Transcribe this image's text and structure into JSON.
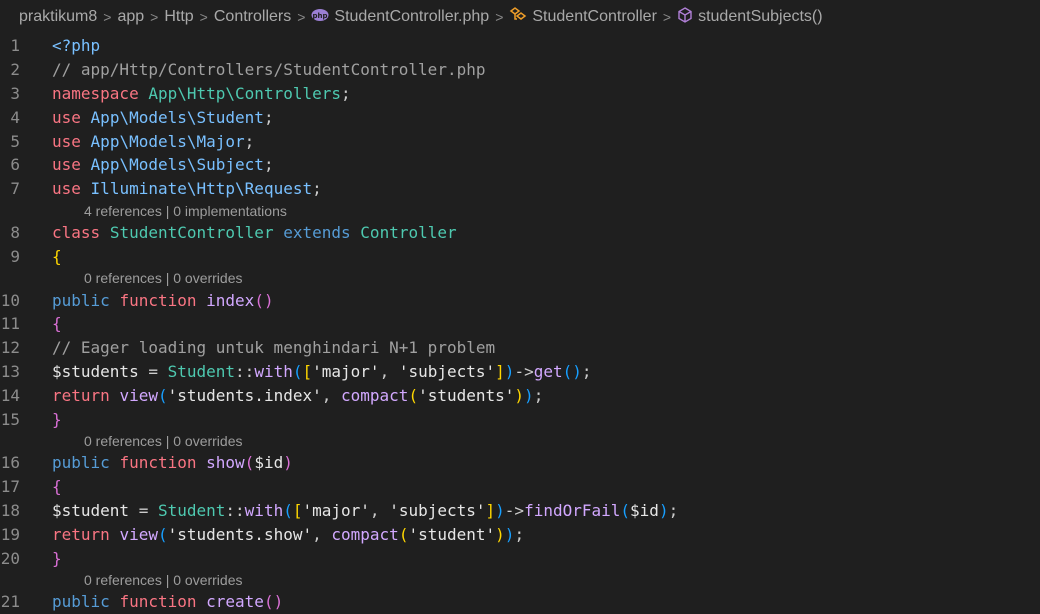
{
  "breadcrumb": {
    "items": [
      "praktikum8",
      "app",
      "Http",
      "Controllers",
      "StudentController.php",
      "StudentController",
      "studentSubjects()"
    ]
  },
  "lens": {
    "class": "4 references | 0 implementations",
    "index": "0 references | 0 overrides",
    "show": "0 references | 0 overrides",
    "create": "0 references | 0 overrides"
  },
  "lines": [
    {
      "n": "1"
    },
    {
      "n": "2"
    },
    {
      "n": "3"
    },
    {
      "n": "4"
    },
    {
      "n": "5"
    },
    {
      "n": "6"
    },
    {
      "n": "7"
    },
    {
      "n": "8"
    },
    {
      "n": "9"
    },
    {
      "n": "10"
    },
    {
      "n": "11"
    },
    {
      "n": "12"
    },
    {
      "n": "13"
    },
    {
      "n": "14"
    },
    {
      "n": "15"
    },
    {
      "n": "16"
    },
    {
      "n": "17"
    },
    {
      "n": "18"
    },
    {
      "n": "19"
    },
    {
      "n": "20"
    },
    {
      "n": "21"
    }
  ],
  "code": {
    "l1": "<?php",
    "l2": "// app/Http/Controllers/StudentController.php",
    "l3_kw": "namespace",
    "l3_ns": "App\\Http\\Controllers",
    "use": "use",
    "l4_ns": "App\\Models\\Student",
    "l5_ns": "App\\Models\\Major",
    "l6_ns": "App\\Models\\Subject",
    "l7_ns": "Illuminate\\Http\\Request",
    "class_kw": "class",
    "class_name": "StudentController",
    "extends_kw": "extends",
    "parent": "Controller",
    "public": "public",
    "function": "function",
    "index": "index",
    "show": "show",
    "create": "create",
    "l12": "// Eager loading untuk menghindari N+1 problem",
    "var_students": "$students",
    "var_student": "$student",
    "var_id": "$id",
    "model": "Student",
    "with": "with",
    "major": "'major'",
    "subjects": "'subjects'",
    "get": "get",
    "findOrFail": "findOrFail",
    "return": "return",
    "view": "view",
    "compact": "compact",
    "s_index": "'students.index'",
    "s_show": "'students.show'",
    "s_students": "'students'",
    "s_student": "'student'"
  }
}
